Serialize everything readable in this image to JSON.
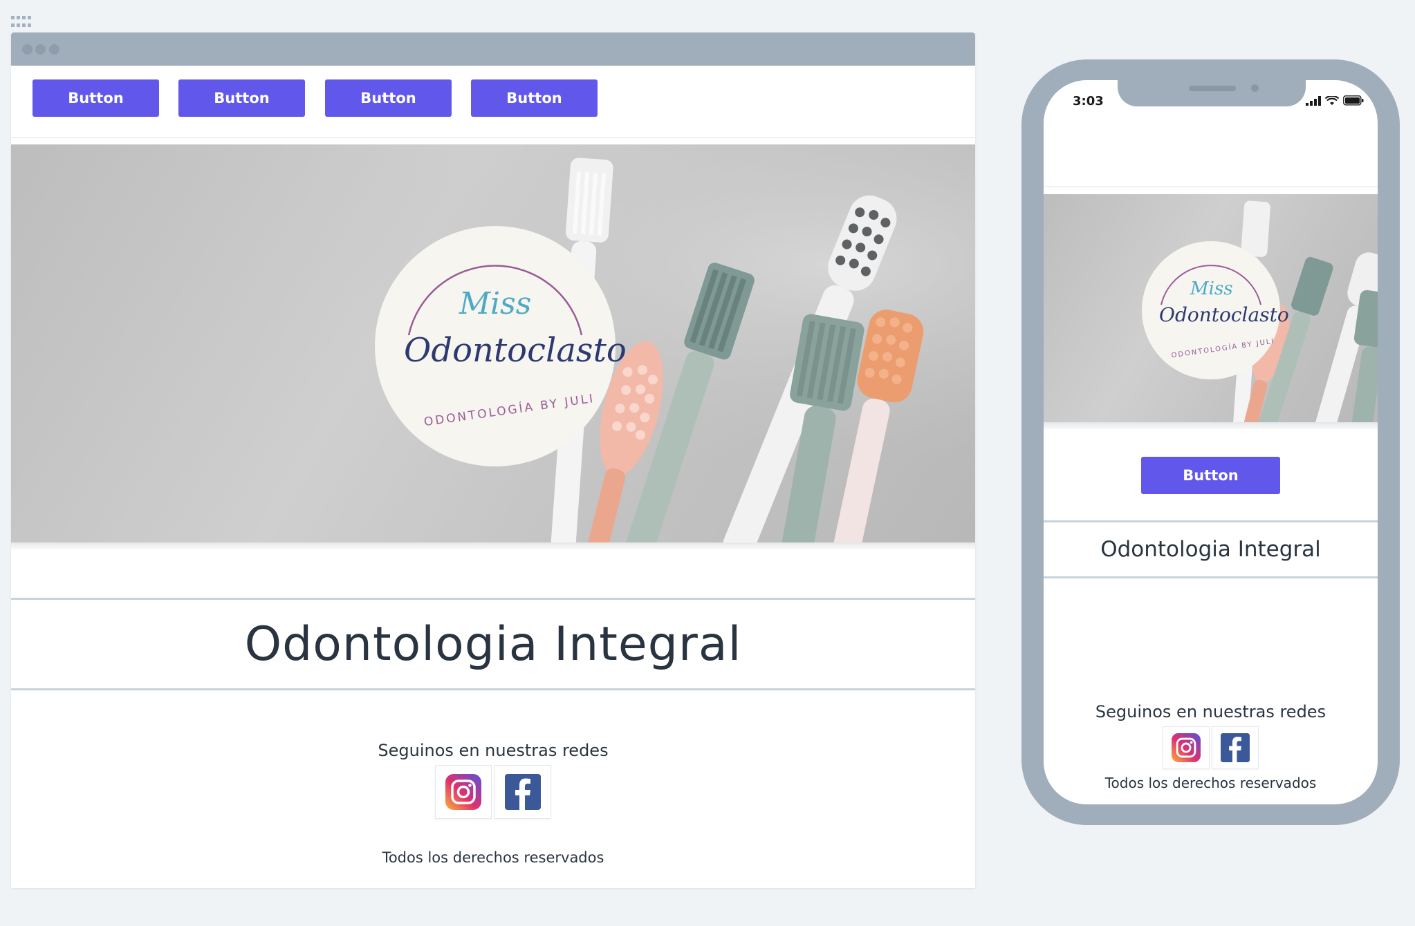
{
  "desktop": {
    "nav_buttons": [
      "Button",
      "Button",
      "Button",
      "Button"
    ],
    "logo": {
      "script_small": "Miss",
      "script_large": "Odontoclasto",
      "arc_text": "ODONTOLOGÍA BY JULI"
    },
    "title": "Odontologia Integral",
    "follow_text": "Seguinos en nuestras redes",
    "rights_text": "Todos los derechos reservados"
  },
  "mobile": {
    "time": "3:03",
    "button_label": "Button",
    "title": "Odontologia Integral",
    "follow_text": "Seguinos en nuestras redes",
    "rights_text": "Todos los derechos reservados"
  },
  "colors": {
    "accent": "#6157eb",
    "frame": "#a0adba",
    "text": "#2a3441"
  },
  "icons": [
    "grid-icon",
    "instagram-icon",
    "facebook-icon",
    "signal-icon",
    "wifi-icon",
    "battery-icon"
  ]
}
